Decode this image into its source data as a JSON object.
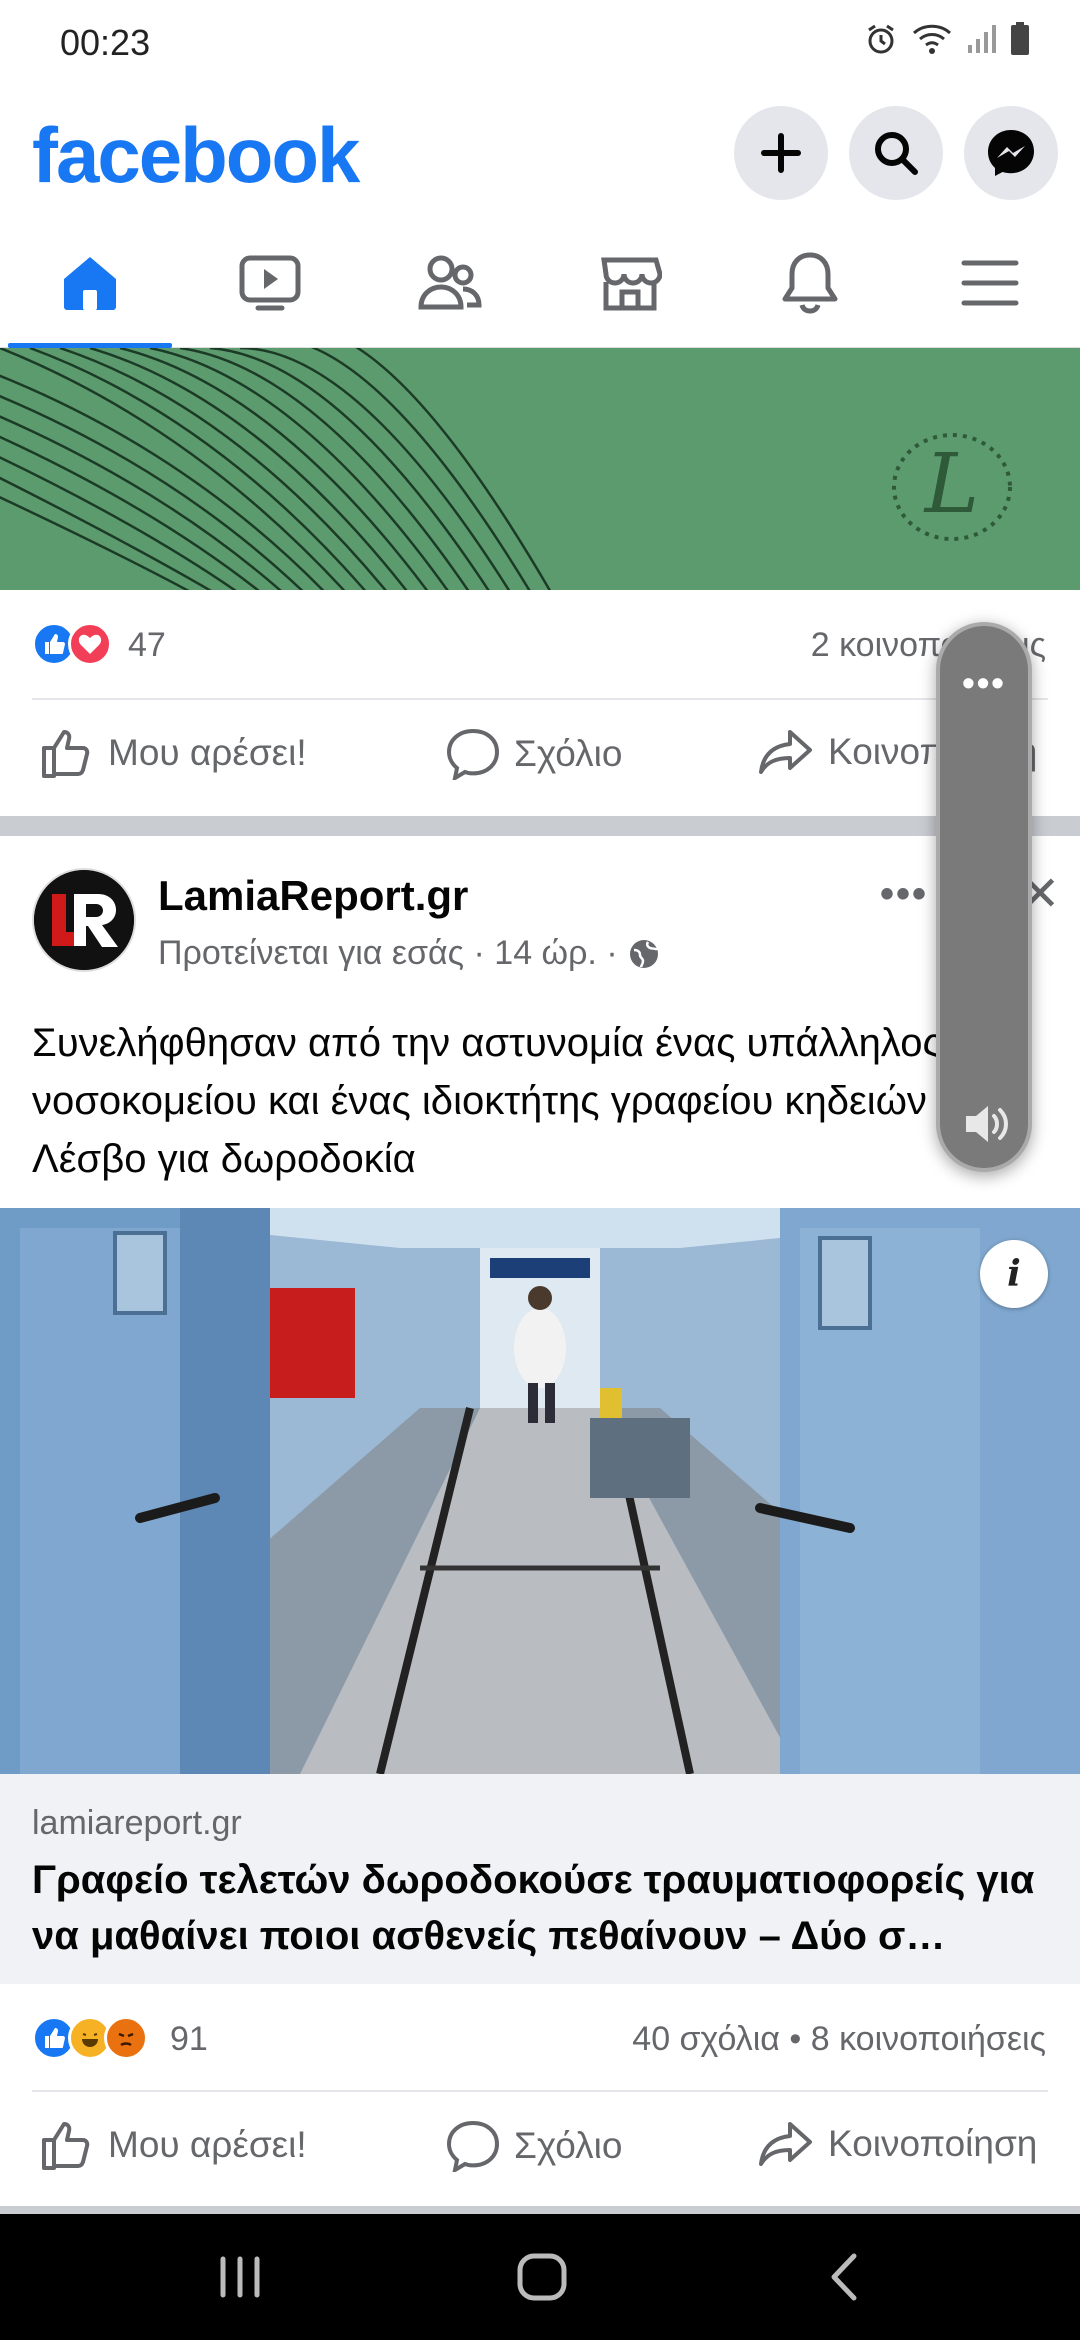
{
  "status_bar": {
    "time": "00:23",
    "icons": [
      "alarm-icon",
      "wifi-icon",
      "signal-icon",
      "battery-icon"
    ]
  },
  "header": {
    "logo": "facebook",
    "buttons": [
      "create-icon",
      "search-icon",
      "messenger-icon"
    ]
  },
  "tabs": [
    "home",
    "watch",
    "friends",
    "marketplace",
    "notifications",
    "menu"
  ],
  "post1": {
    "reactions_count": "47",
    "shares": "2 κοινοποιήσεις",
    "actions": {
      "like": "Μου αρέσει!",
      "comment": "Σχόλιο",
      "share": "Κοινοποίηση"
    }
  },
  "post2": {
    "page_name": "LamiaReport.gr",
    "meta": "Προτείνεται για εσάς · 14 ώρ. ·",
    "text": "Συνελήφθησαν από την αστυνομία ένας υπάλληλος νοσοκομείου και ένας ιδιοκτήτης γραφείου κηδειών στη Λέσβο για δωροδοκία",
    "link_domain": "lamiareport.gr",
    "link_title": "Γραφείο τελετών δωροδοκούσε τραυματιοφορείς για να μαθαίνει ποιοι ασθενείς πεθαίνουν – Δύο σ…",
    "reactions_count": "91",
    "comments_shares": "40 σχόλια • 8 κοινοποιήσεις",
    "actions": {
      "like": "Μου αρέσει!",
      "comment": "Σχόλιο",
      "share": "Κοινοποίηση"
    }
  },
  "colors": {
    "brand": "#1877f2",
    "banner": "#5c9b6d",
    "muted_text": "#65676b"
  }
}
